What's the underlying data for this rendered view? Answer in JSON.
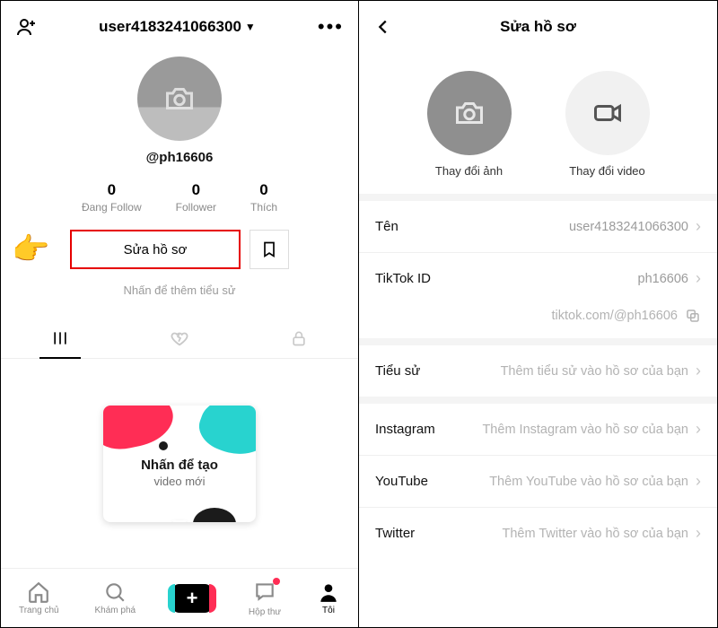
{
  "left": {
    "header": {
      "username": "user4183241066300"
    },
    "handle": "@ph16606",
    "stats": {
      "following": {
        "count": "0",
        "label": "Đang Follow"
      },
      "followers": {
        "count": "0",
        "label": "Follower"
      },
      "likes": {
        "count": "0",
        "label": "Thích"
      }
    },
    "edit_profile_label": "Sửa hồ sơ",
    "bio_hint": "Nhấn để thêm tiểu sử",
    "create_card": {
      "line1": "Nhấn để tạo",
      "line2": "video mới"
    },
    "nav": {
      "home": "Trang chủ",
      "discover": "Khám phá",
      "inbox": "Hộp thư",
      "me": "Tôi"
    }
  },
  "right": {
    "header_title": "Sửa hồ sơ",
    "change_photo": "Thay đổi ảnh",
    "change_video": "Thay đổi video",
    "rows": {
      "name": {
        "k": "Tên",
        "v": "user4183241066300"
      },
      "tiktok_id": {
        "k": "TikTok ID",
        "v": "ph16606"
      },
      "link": "tiktok.com/@ph16606",
      "bio": {
        "k": "Tiểu sử",
        "v": "Thêm tiểu sử vào hồ sơ của bạn"
      },
      "instagram": {
        "k": "Instagram",
        "v": "Thêm Instagram vào hồ sơ của bạn"
      },
      "youtube": {
        "k": "YouTube",
        "v": "Thêm YouTube vào hồ sơ của bạn"
      },
      "twitter": {
        "k": "Twitter",
        "v": "Thêm Twitter vào hồ sơ của bạn"
      }
    }
  }
}
